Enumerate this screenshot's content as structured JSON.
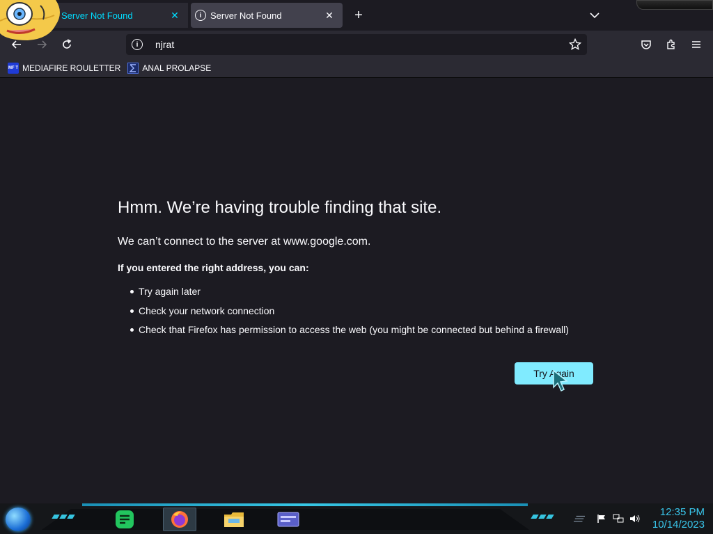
{
  "tabs": [
    {
      "title": "Server Not Found",
      "close_glyph": "✕",
      "color": "#00ddff"
    },
    {
      "title": "Server Not Found",
      "close_glyph": "✕"
    }
  ],
  "tabstrip": {
    "new_tab_glyph": "+"
  },
  "navbar": {
    "url": "njrat",
    "icons": [
      "back-arrow-icon",
      "forward-arrow-icon",
      "reload-icon",
      "info-icon",
      "star-icon",
      "pocket-icon",
      "extensions-icon",
      "hamburger-menu-icon"
    ]
  },
  "bookmarks": [
    {
      "label": "MEDIAFIRE ROULETTER",
      "icon_text": "MF T"
    },
    {
      "label": "ANAL PROLAPSE"
    }
  ],
  "error": {
    "title": "Hmm. We’re having trouble finding that site.",
    "subtitle": "We can’t connect to the server at www.google.com.",
    "lead": "If you entered the right address, you can:",
    "items": [
      "Try again later",
      "Check your network connection",
      "Check that Firefox has permission to access the web (you might be connected but behind a firewall)"
    ],
    "button": "Try Again"
  },
  "taskbar": {
    "apps": [
      "notes-app-icon",
      "firefox-icon",
      "file-explorer-icon",
      "window-app-icon"
    ],
    "tray": [
      "flag-icon",
      "network-icon",
      "volume-icon"
    ],
    "time": "12:35 PM",
    "date": "10/14/2023"
  },
  "colors": {
    "page_bg": "#1c1b22",
    "toolbar_bg": "#2b2a33",
    "accent": "#00ddff",
    "button_bg": "#80ebff",
    "clock": "#39c5ea"
  }
}
